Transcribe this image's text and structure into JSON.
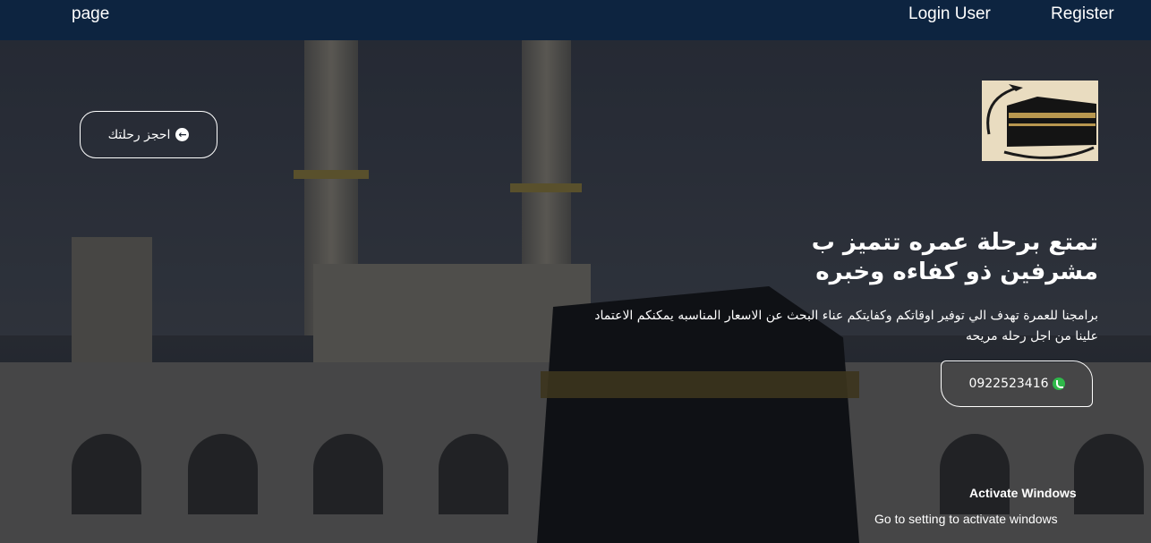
{
  "nav": {
    "page_label": "page",
    "login_label": "Login User",
    "register_label": "Register"
  },
  "hero": {
    "book_button_label": "احجز رحلتك",
    "headline_line1": "تمتع برحلة عمره تتميز ب",
    "headline_line2": "مشرفين ذو كفاءه وخبره",
    "description": "برامجنا للعمرة تهدف الي توفير اوقاتكم وكفايتكم عناء البحث عن الاسعار المناسبه يمكنكم الاعتماد علينا من اجل رحله مريحه",
    "phone_number": "0922523416"
  },
  "watermark": {
    "title": "Activate Windows",
    "subtitle": "Go to setting to activate windows"
  },
  "icons": {
    "book_icon": "circle-arrow-left-icon",
    "phone_icon": "whatsapp-icon"
  },
  "colors": {
    "navbar": "#0d2440",
    "whatsapp": "#2fb94a",
    "logo_bg": "#e9dcc0"
  }
}
